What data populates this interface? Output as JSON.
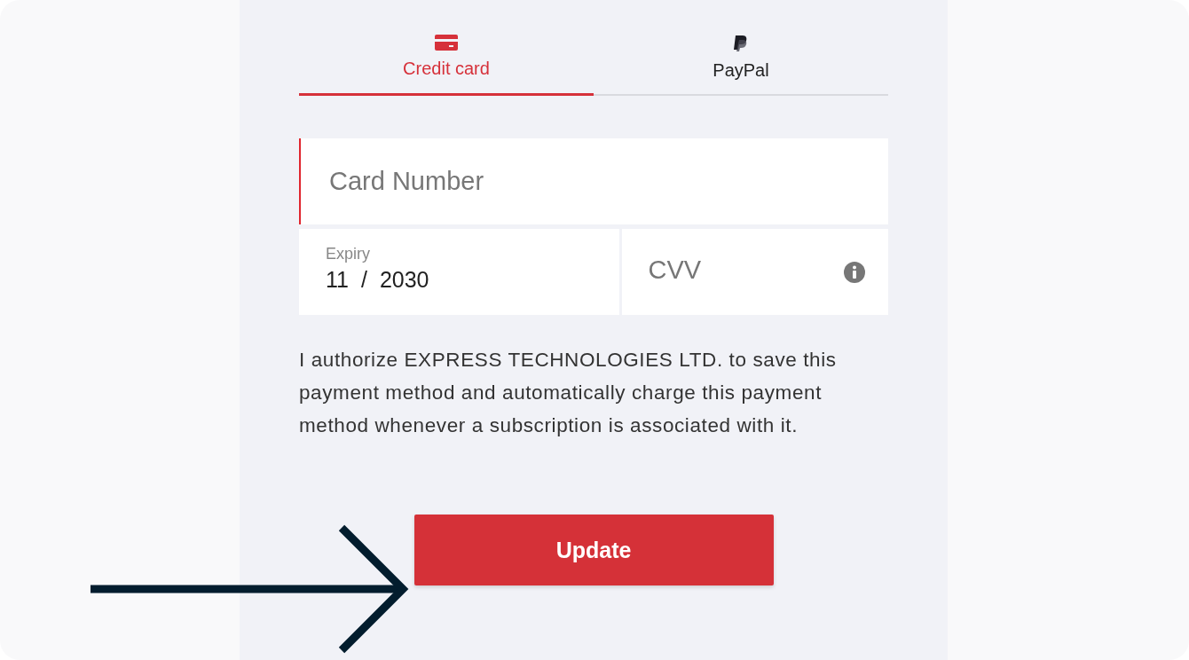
{
  "tabs": [
    {
      "label": "Credit card",
      "kind": "card",
      "selected": true
    },
    {
      "label": "PayPal",
      "kind": "paypal",
      "selected": false
    }
  ],
  "card_number": {
    "placeholder": "Card Number",
    "focused": true
  },
  "expiry": {
    "label": "Expiry",
    "month": "11",
    "separator": "/",
    "year": "2030"
  },
  "cvv": {
    "placeholder": "CVV"
  },
  "authorization_text": "I authorize EXPRESS TECHNOLOGIES LTD. to save this payment method and automatically charge this payment method whenever a subscription is associated with it.",
  "update_button": "Update"
}
